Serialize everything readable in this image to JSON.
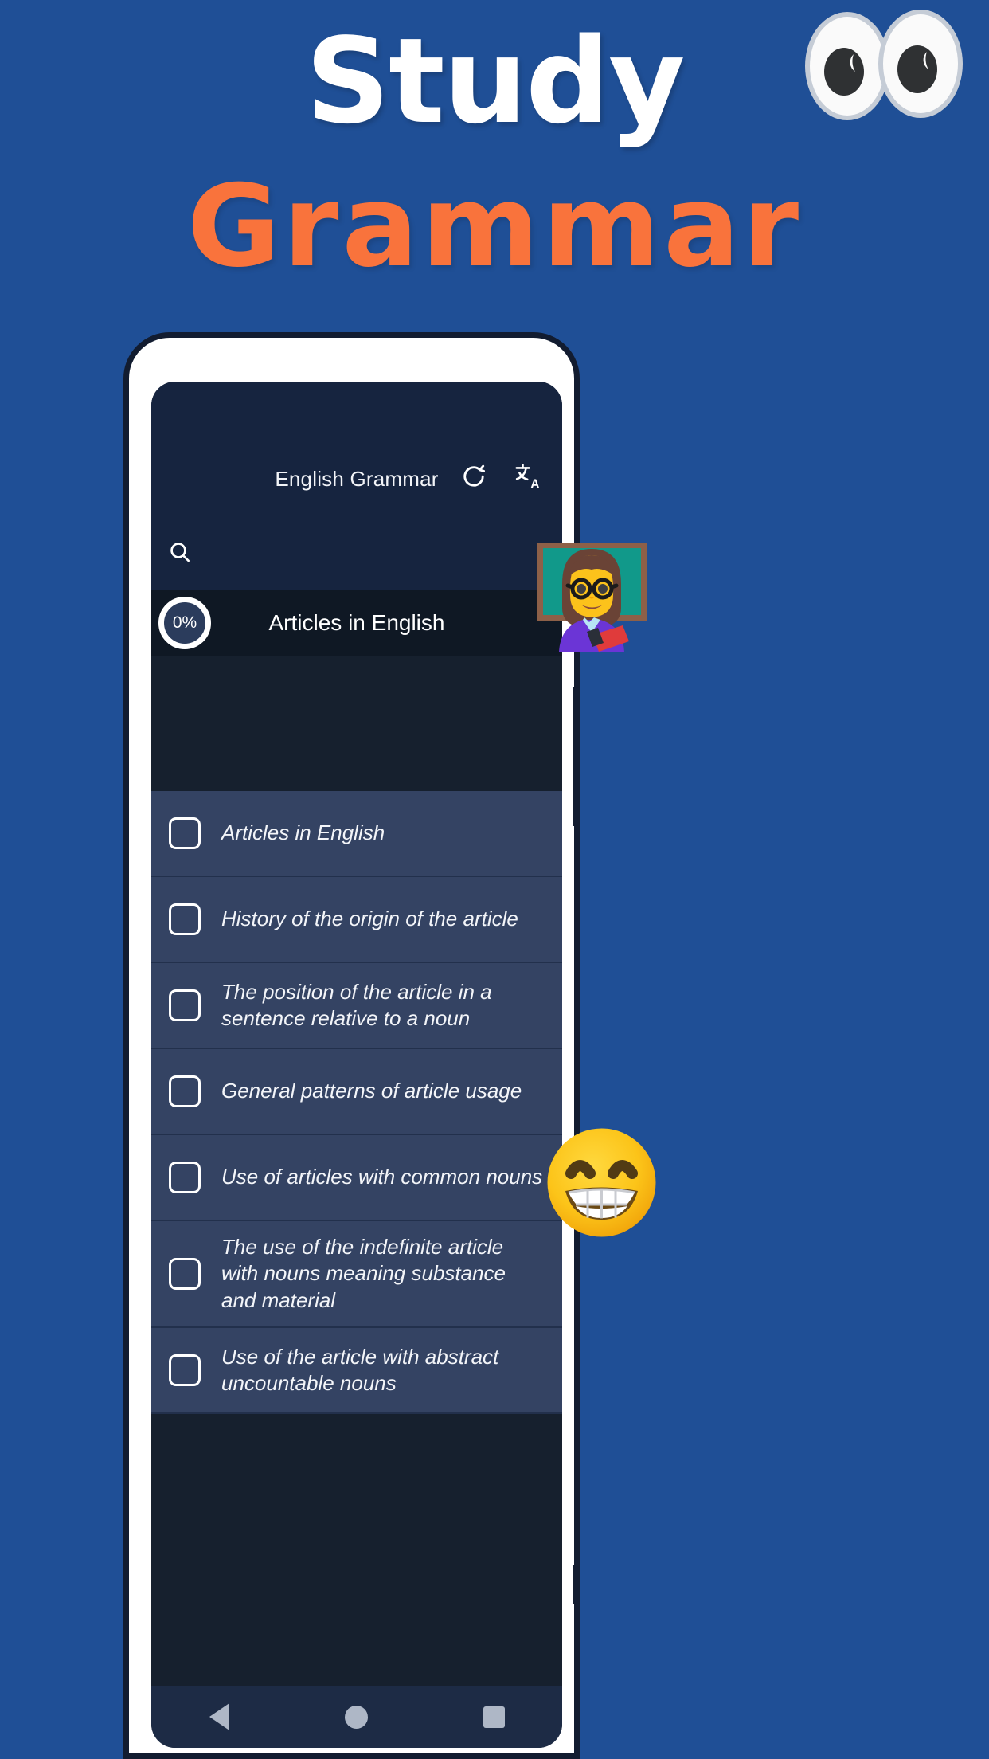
{
  "promo": {
    "background_color": "#1f4f96",
    "headline_line1": "Study",
    "headline_line2": "Grammar",
    "headline_line1_color": "#ffffff",
    "headline_line2_color": "#f9733c",
    "stickers": [
      {
        "name": "eyes-emoji",
        "glyph": "👀"
      },
      {
        "name": "woman-teacher-emoji",
        "glyph": "👩‍🏫"
      },
      {
        "name": "beaming-face-emoji",
        "glyph": "😁"
      }
    ]
  },
  "app": {
    "appbar": {
      "title": "English Grammar",
      "background_color": "#16243f",
      "actions": [
        {
          "name": "refresh-icon",
          "label": "Refresh"
        },
        {
          "name": "translate-icon",
          "label": "Translate"
        }
      ]
    },
    "search": {
      "icon": "search-icon",
      "value": "",
      "placeholder": ""
    },
    "current_topic": {
      "progress_percent": "0%",
      "title": "Articles in English",
      "background_color": "#0f1824"
    },
    "list": {
      "background_color": "#344363",
      "items": [
        {
          "label": "Articles in English",
          "checked": false
        },
        {
          "label": "History of the origin of the article",
          "checked": false
        },
        {
          "label": "The position of the article in a sentence relative to a noun",
          "checked": false
        },
        {
          "label": "General patterns of article usage",
          "checked": false
        },
        {
          "label": "Use of articles with common nouns",
          "checked": false
        },
        {
          "label": "The use of the indefinite article with nouns meaning substance and material",
          "checked": false
        },
        {
          "label": "Use of the article with abstract uncountable nouns",
          "checked": false
        }
      ]
    },
    "navbar": {
      "background_color": "#1d2b45",
      "buttons": [
        {
          "name": "nav-back-button",
          "label": "Back"
        },
        {
          "name": "nav-home-button",
          "label": "Home"
        },
        {
          "name": "nav-recents-button",
          "label": "Recents"
        }
      ]
    }
  }
}
